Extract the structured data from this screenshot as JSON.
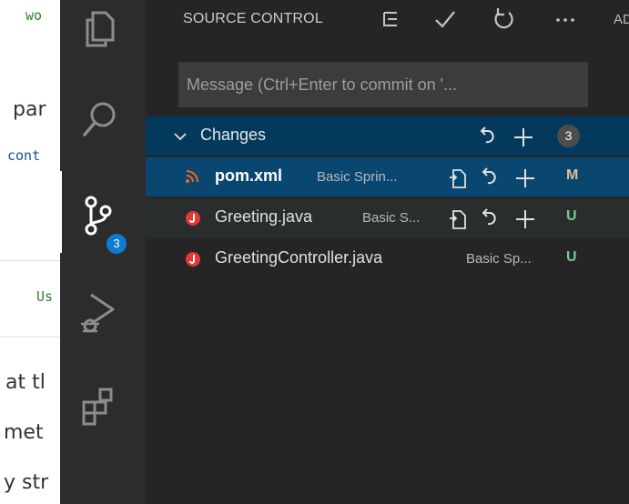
{
  "background_page": {
    "snippets": [
      "wo",
      "par",
      "cont",
      "Us",
      "at tl",
      "met",
      "y str"
    ]
  },
  "activity_bar": {
    "items": [
      {
        "name": "explorer",
        "icon": "files-icon"
      },
      {
        "name": "search",
        "icon": "search-icon"
      },
      {
        "name": "source-control",
        "icon": "source-control-icon",
        "badge": "3"
      },
      {
        "name": "run-and-debug",
        "icon": "run-debug-icon"
      },
      {
        "name": "extensions",
        "icon": "extensions-icon"
      }
    ]
  },
  "sidebar": {
    "title": "SOURCE CONTROL",
    "cut_text": "AD",
    "header_icons": [
      "view-as-tree-icon",
      "commit-check-icon",
      "refresh-icon",
      "more-actions-icon"
    ],
    "commit_placeholder": "Message (Ctrl+Enter to commit on '...",
    "commit_value": "",
    "changes_group": {
      "label": "Changes",
      "count": "3",
      "actions": [
        "discard-all-icon",
        "stage-all-icon"
      ]
    },
    "files": [
      {
        "name": "pom.xml",
        "description": "Basic Sprin...",
        "status": "M",
        "status_color": "#e2c08d",
        "icon": "rss-xml-icon",
        "icon_color": "#f26522",
        "selected": true
      },
      {
        "name": "Greeting.java",
        "description": "Basic S...",
        "status": "U",
        "status_color": "#73c991",
        "icon": "java-icon",
        "icon_color": "#e53935",
        "selected": false
      },
      {
        "name": "GreetingController.java",
        "description": "Basic Sp...",
        "status": "U",
        "status_color": "#73c991",
        "icon": "java-icon",
        "icon_color": "#e53935",
        "selected": false
      }
    ]
  },
  "colors": {
    "activity_bar": "#2c2c2c",
    "sidebar": "#252526",
    "selection": "#094771",
    "group_focus": "#04395e",
    "badge": "#0e7ad1"
  }
}
